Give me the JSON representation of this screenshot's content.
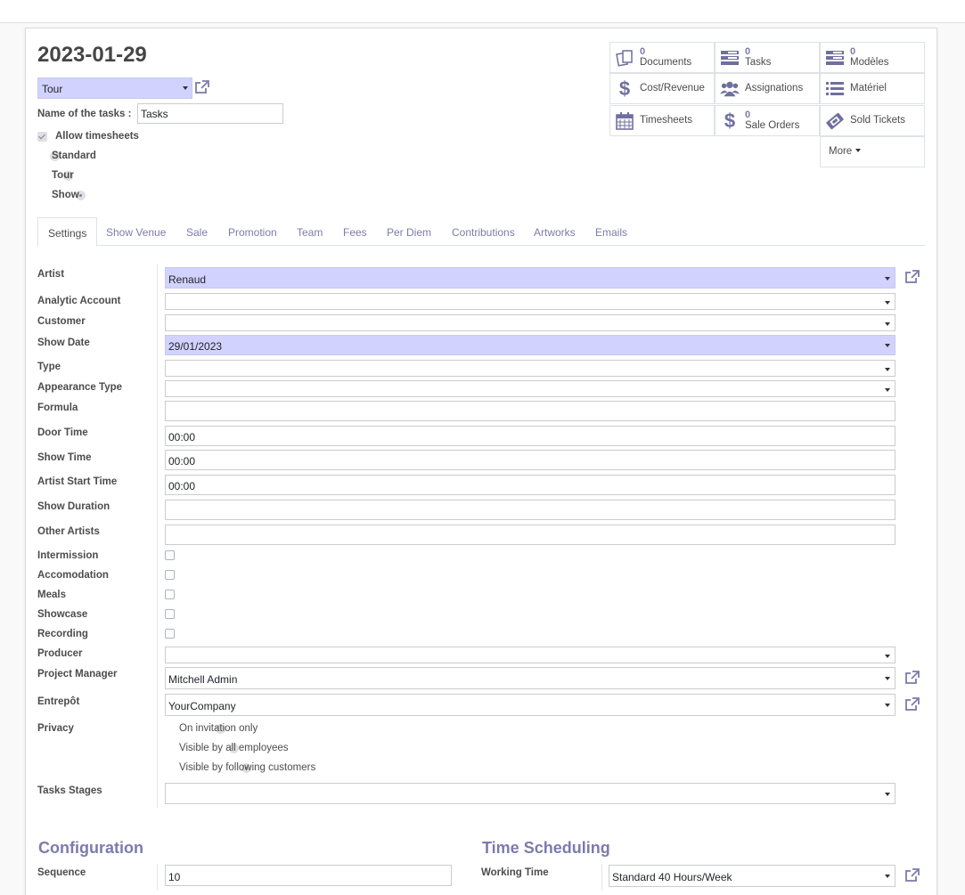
{
  "record": {
    "title": "2023-01-29",
    "type_select": "Tour",
    "tasks_name_label": "Name of the tasks :",
    "tasks_name_value": "Tasks",
    "allow_timesheets_label": "Allow timesheets",
    "kind_options": [
      "Standard",
      "Tour",
      "Show"
    ],
    "kind_selected": "Show"
  },
  "smart_buttons": {
    "documents": {
      "count": "0",
      "label": "Documents"
    },
    "tasks": {
      "count": "0",
      "label": "Tasks"
    },
    "modeles": {
      "count": "0",
      "label": "Modèles"
    },
    "cost_revenue": {
      "label": "Cost/Revenue"
    },
    "assignations": {
      "label": "Assignations"
    },
    "materiel": {
      "label": "Matériel"
    },
    "timesheets": {
      "label": "Timesheets"
    },
    "sale_orders": {
      "count": "0",
      "label": "Sale Orders"
    },
    "sold_tickets": {
      "label": "Sold Tickets"
    },
    "more": {
      "label": "More"
    }
  },
  "tabs": [
    "Settings",
    "Show Venue",
    "Sale",
    "Promotion",
    "Team",
    "Fees",
    "Per Diem",
    "Contributions",
    "Artworks",
    "Emails"
  ],
  "active_tab": "Settings",
  "fields": {
    "artist": {
      "label": "Artist",
      "value": "Renaud"
    },
    "analytic_account": {
      "label": "Analytic Account",
      "value": ""
    },
    "customer": {
      "label": "Customer",
      "value": ""
    },
    "show_date": {
      "label": "Show Date",
      "value": "29/01/2023"
    },
    "type": {
      "label": "Type",
      "value": ""
    },
    "appearance_type": {
      "label": "Appearance Type",
      "value": ""
    },
    "formula": {
      "label": "Formula",
      "value": ""
    },
    "door_time": {
      "label": "Door Time",
      "value": "00:00"
    },
    "show_time": {
      "label": "Show Time",
      "value": "00:00"
    },
    "artist_start_time": {
      "label": "Artist Start Time",
      "value": "00:00"
    },
    "show_duration": {
      "label": "Show Duration",
      "value": ""
    },
    "other_artists": {
      "label": "Other Artists",
      "value": ""
    },
    "intermission": {
      "label": "Intermission",
      "checked": false
    },
    "accomodation": {
      "label": "Accomodation",
      "checked": false
    },
    "meals": {
      "label": "Meals",
      "checked": false
    },
    "showcase": {
      "label": "Showcase",
      "checked": false
    },
    "recording": {
      "label": "Recording",
      "checked": false
    },
    "producer": {
      "label": "Producer",
      "value": ""
    },
    "project_manager": {
      "label": "Project Manager",
      "value": "Mitchell Admin"
    },
    "entrepot": {
      "label": "Entrepôt",
      "value": "YourCompany"
    },
    "privacy": {
      "label": "Privacy",
      "options": [
        "On invitation only",
        "Visible by all employees",
        "Visible by following customers"
      ],
      "selected": "Visible by following customers"
    },
    "tasks_stages": {
      "label": "Tasks Stages",
      "value": ""
    }
  },
  "configuration": {
    "title": "Configuration",
    "sequence_label": "Sequence",
    "sequence_value": "10"
  },
  "time_scheduling": {
    "title": "Time Scheduling",
    "working_time_label": "Working Time",
    "working_time_value": "Standard 40 Hours/Week"
  },
  "colors": {
    "accent": "#7c7bad",
    "highlight": "#d2d2ff"
  }
}
